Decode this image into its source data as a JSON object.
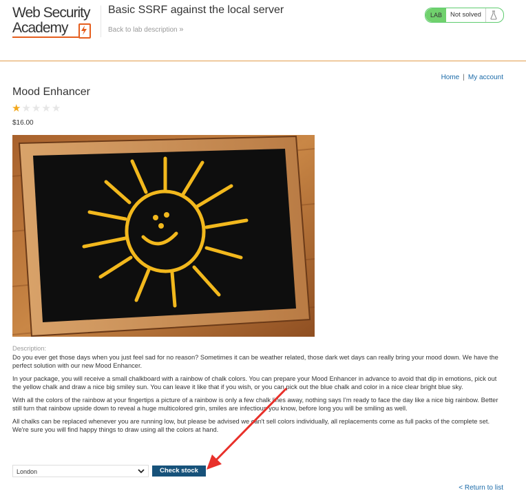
{
  "header": {
    "logo_line1": "Web Security",
    "logo_line2": "Academy",
    "lab_title": "Basic SSRF against the local server",
    "back_link": "Back to lab description",
    "back_link_chevron": "»",
    "lab_badge": "LAB",
    "lab_status": "Not solved",
    "brand_color": "#e55d1c",
    "badge_color": "#70d16d"
  },
  "nav": {
    "home": "Home",
    "separator": "|",
    "account": "My account"
  },
  "product": {
    "name": "Mood Enhancer",
    "rating": 1,
    "rating_max": 5,
    "price": "$16.00",
    "description_label": "Description:",
    "paragraphs": [
      "Do you ever get those days when you just feel sad for no reason? Sometimes it can be weather related, those dark wet days can really bring your mood down. We have the perfect solution with our new Mood Enhancer.",
      "In your package, you will receive a small chalkboard with a rainbow of chalk colors. You can prepare your Mood Enhancer in advance to avoid that dip in emotions, pick out the yellow chalk and draw a nice big smiley sun. You can leave it like that if you wish, or you can pick out the blue chalk and color in a nice clear bright blue sky.",
      "With all the colors of the rainbow at your fingertips a picture of a rainbow is only a few chalk lines away, nothing says I'm ready to face the day like a nice big rainbow. Better still turn that rainbow upside down to reveal a huge multicolored grin, smiles are infectious you know, before long you will be smiling as well.",
      "All chalks can be replaced whenever you are running low, but please be advised we can't sell colors individually, all replacements come as full packs of the complete set. We're sure you will find happy things to draw using all the colors at hand."
    ]
  },
  "stock": {
    "selected_store": "London",
    "button": "Check stock",
    "button_color": "#17527a"
  },
  "footer": {
    "return_link": "< Return to list"
  },
  "annotation": {
    "arrow_color": "#e8302a"
  }
}
